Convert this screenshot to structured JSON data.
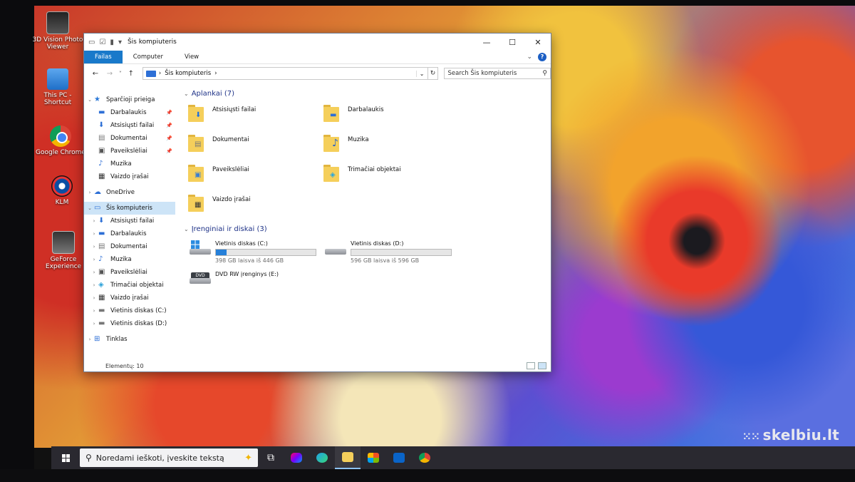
{
  "desktop": {
    "icons": [
      {
        "label": "3D Vision Photo Viewer",
        "icon": "3d-vision-icon"
      },
      {
        "label": "This PC - Shortcut",
        "icon": "computer-icon"
      },
      {
        "label": "Google Chrome",
        "icon": "chrome-icon"
      },
      {
        "label": "KLM",
        "icon": "klm-icon"
      },
      {
        "label": "GeForce Experience",
        "icon": "geforce-icon"
      }
    ],
    "watermark": "skelbiu.lt"
  },
  "window": {
    "title": "Šis kompiuteris",
    "controls": {
      "minimize": "—",
      "maximize": "☐",
      "close": "✕"
    },
    "ribbon_tabs": [
      "Failas",
      "Computer",
      "View"
    ],
    "help": "?",
    "address": "Šis kompiuteris",
    "search_placeholder": "Search Šis kompiuteris",
    "nav_pane": [
      {
        "label": "Sparčioji prieiga",
        "icon": "star-icon",
        "level": 0,
        "expanded": true
      },
      {
        "label": "Darbalaukis",
        "icon": "desktop-icon",
        "level": 1,
        "pinned": true
      },
      {
        "label": "Atsisiųsti failai",
        "icon": "download-icon",
        "level": 1,
        "pinned": true
      },
      {
        "label": "Dokumentai",
        "icon": "document-icon",
        "level": 1,
        "pinned": true
      },
      {
        "label": "Paveikslėliai",
        "icon": "picture-icon",
        "level": 1,
        "pinned": true
      },
      {
        "label": "Muzika",
        "icon": "music-icon",
        "level": 1
      },
      {
        "label": "Vaizdo įrašai",
        "icon": "video-icon",
        "level": 1
      },
      {
        "label": "OneDrive",
        "icon": "cloud-icon",
        "level": 0,
        "expanded": false
      },
      {
        "label": "Šis kompiuteris",
        "icon": "computer-icon",
        "level": 0,
        "expanded": true,
        "selected": true
      },
      {
        "label": "Atsisiųsti failai",
        "icon": "download-icon",
        "level": 1
      },
      {
        "label": "Darbalaukis",
        "icon": "desktop-icon",
        "level": 1
      },
      {
        "label": "Dokumentai",
        "icon": "document-icon",
        "level": 1
      },
      {
        "label": "Muzika",
        "icon": "music-icon",
        "level": 1
      },
      {
        "label": "Paveikslėliai",
        "icon": "picture-icon",
        "level": 1
      },
      {
        "label": "Trimačiai objektai",
        "icon": "cube-icon",
        "level": 1
      },
      {
        "label": "Vaizdo įrašai",
        "icon": "video-icon",
        "level": 1
      },
      {
        "label": "Vietinis diskas (C:)",
        "icon": "drive-icon",
        "level": 1
      },
      {
        "label": "Vietinis diskas (D:)",
        "icon": "drive-icon",
        "level": 1
      },
      {
        "label": "Tinklas",
        "icon": "network-icon",
        "level": 0,
        "expanded": false
      }
    ],
    "folders_header": "Aplankai (7)",
    "folders": [
      {
        "label": "Atsisiųsti failai",
        "icon": "download-icon"
      },
      {
        "label": "Darbalaukis",
        "icon": "desktop-icon"
      },
      {
        "label": "Dokumentai",
        "icon": "document-icon"
      },
      {
        "label": "Muzika",
        "icon": "music-icon"
      },
      {
        "label": "Paveikslėliai",
        "icon": "picture-icon"
      },
      {
        "label": "Trimačiai objektai",
        "icon": "cube-icon"
      },
      {
        "label": "Vaizdo įrašai",
        "icon": "video-icon"
      }
    ],
    "devices_header": "Įrenginiai ir diskai (3)",
    "drives": [
      {
        "label": "Vietinis diskas (C:)",
        "free": "398 GB laisva iš 446 GB",
        "used_fraction": 0.11
      },
      {
        "label": "Vietinis diskas (D:)",
        "free": "596 GB laisva iš 596 GB",
        "used_fraction": 0.0
      }
    ],
    "dvd": {
      "label": "DVD RW įrenginys (E:)",
      "badge": "DVD"
    },
    "status": "Elementų: 10"
  },
  "taskbar": {
    "search_placeholder": "Noredami ieškoti, įveskite tekstą",
    "icons": [
      "task-view-icon",
      "copilot-icon",
      "edge-icon",
      "file-explorer-icon",
      "store-icon",
      "outlook-icon",
      "chrome-icon"
    ],
    "active": "file-explorer-icon"
  }
}
